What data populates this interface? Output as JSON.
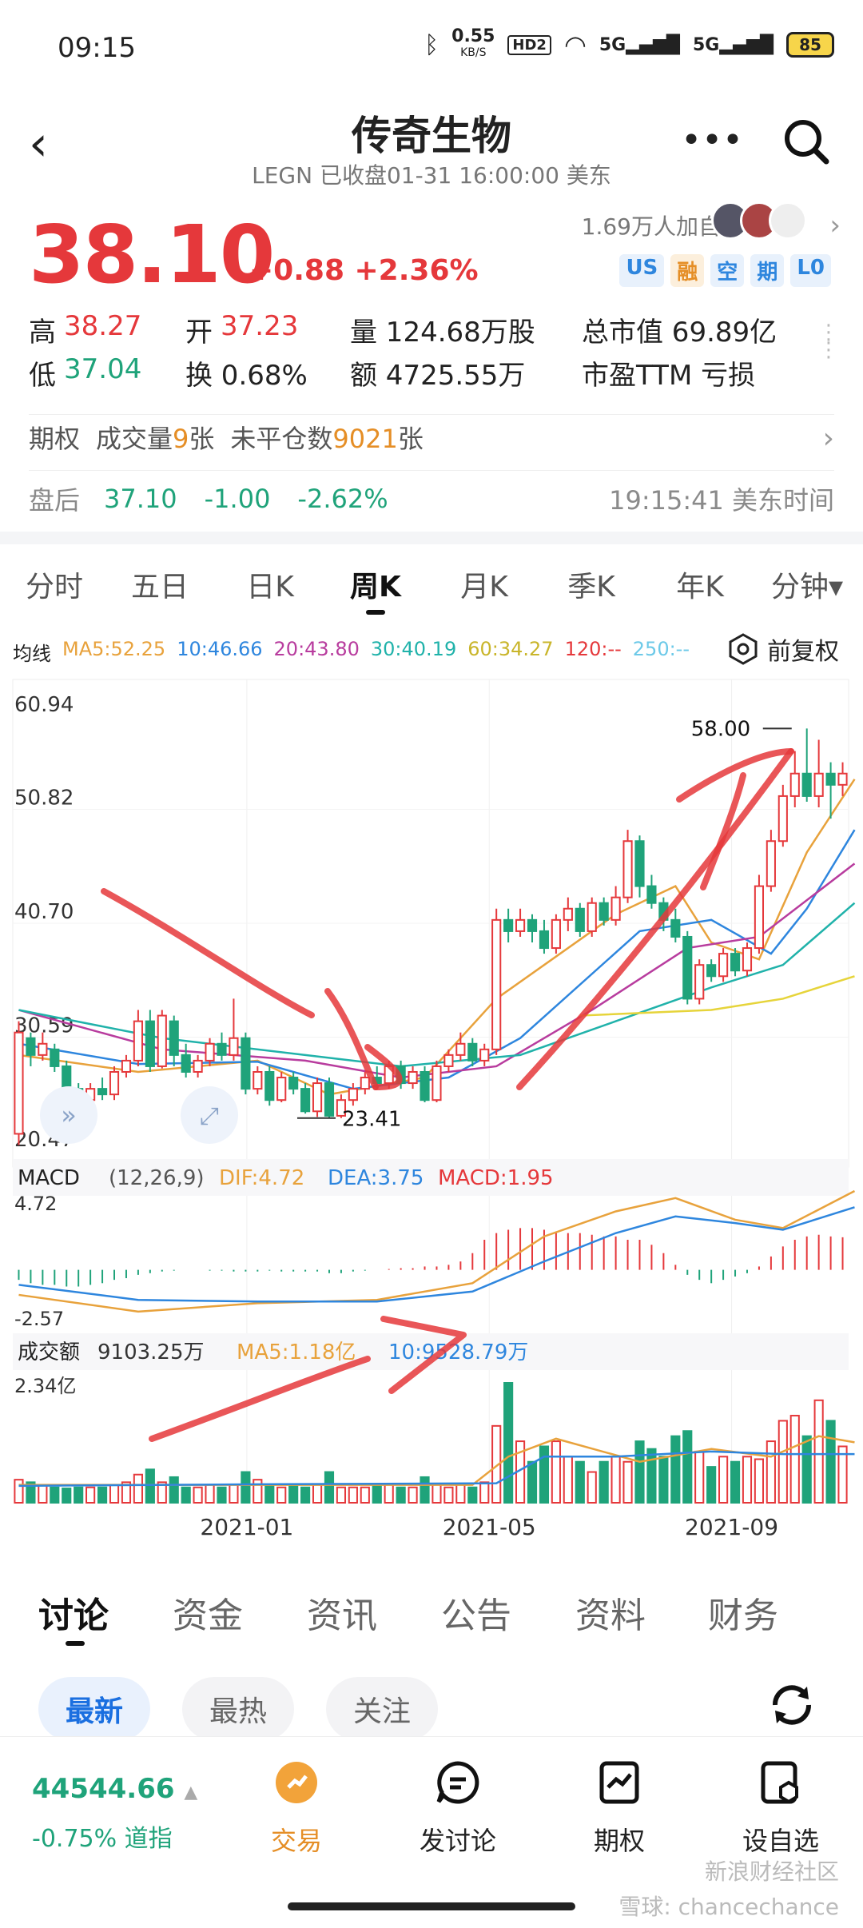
{
  "status": {
    "time": "09:15",
    "net_speed": "0.55",
    "net_unit": "KB/S",
    "hd": "HD2",
    "sig1": "5G",
    "sig2": "5G",
    "battery": "85"
  },
  "header": {
    "title": "传奇生物",
    "subtitle": "LEGN 已收盘01-31 16:00:00 美东"
  },
  "quote": {
    "price": "38.10",
    "change": "+0.88 +2.36%",
    "followers": "1.69万人加自选",
    "tags": [
      "US",
      "融",
      "空",
      "期",
      "L0"
    ]
  },
  "stats": {
    "high_label": "高",
    "high": "38.27",
    "open_label": "开",
    "open": "37.23",
    "volume": "量 124.68万股",
    "mktcap": "总市值 69.89亿",
    "low_label": "低",
    "low": "37.04",
    "turnover": "换 0.68%",
    "amount": "额 4725.55万",
    "pe": "市盈TTM 亏损"
  },
  "options": {
    "label": "期权",
    "vol_label": "成交量",
    "vol": "9",
    "vol_unit": "张",
    "oi_label": "未平仓数",
    "oi": "9021",
    "oi_unit": "张"
  },
  "after_hours": {
    "label": "盘后",
    "price": "37.10",
    "change": "-1.00",
    "pct": "-2.62%",
    "time": "19:15:41 美东时间"
  },
  "tabs": [
    "分时",
    "五日",
    "日K",
    "周K",
    "月K",
    "季K",
    "年K",
    "分钟▾"
  ],
  "ma": {
    "label": "均线",
    "ma5": "MA5:52.25",
    "ma10": "10:46.66",
    "ma20": "20:43.80",
    "ma30": "30:40.19",
    "ma60": "60:34.27",
    "ma120": "120:--",
    "ma250": "250:--",
    "rehab": "前复权"
  },
  "colors": {
    "up": "#e5383b",
    "down": "#1fa37a",
    "ma5": "#e8a23c",
    "ma10": "#2e86de",
    "ma20": "#b83c9e",
    "ma30": "#20b2aa",
    "ma60": "#e6d43a"
  },
  "chart_data": {
    "type": "candlestick",
    "y_ticks": [
      "60.94",
      "50.82",
      "40.70",
      "30.59",
      "20.47"
    ],
    "high_marker": "58.00",
    "low_marker": "23.41",
    "macd": {
      "label": "MACD",
      "params": "(12,26,9)",
      "dif": "DIF:4.72",
      "dea": "DEA:3.75",
      "macd": "MACD:1.95",
      "y_top": "4.72",
      "y_bottom": "-2.57"
    },
    "turnover": {
      "label": "成交额",
      "value": "9103.25万",
      "ma5": "MA5:1.18亿",
      "ma10": "10:9528.79万",
      "y_top": "2.34亿"
    },
    "x_ticks": [
      "2021-01",
      "2021-05",
      "2021-09"
    ],
    "candles": [
      {
        "o": 22,
        "c": 31,
        "h": 32,
        "l": 21
      },
      {
        "o": 30.5,
        "c": 29,
        "h": 31,
        "l": 28
      },
      {
        "o": 29,
        "c": 30,
        "h": 31,
        "l": 28.5
      },
      {
        "o": 29.5,
        "c": 28,
        "h": 30,
        "l": 27.5
      },
      {
        "o": 28,
        "c": 26,
        "h": 28.5,
        "l": 25.5
      },
      {
        "o": 26,
        "c": 25,
        "h": 26.5,
        "l": 24.5
      },
      {
        "o": 25,
        "c": 26,
        "h": 26.5,
        "l": 24.8
      },
      {
        "o": 26,
        "c": 25.5,
        "h": 27,
        "l": 25
      },
      {
        "o": 25.5,
        "c": 27.5,
        "h": 28,
        "l": 25
      },
      {
        "o": 27.5,
        "c": 28.5,
        "h": 29,
        "l": 27
      },
      {
        "o": 28.5,
        "c": 32,
        "h": 33,
        "l": 28
      },
      {
        "o": 32,
        "c": 28,
        "h": 33,
        "l": 27.5
      },
      {
        "o": 28,
        "c": 32.5,
        "h": 33,
        "l": 27.8
      },
      {
        "o": 32,
        "c": 29,
        "h": 32.5,
        "l": 28
      },
      {
        "o": 29,
        "c": 27.5,
        "h": 30,
        "l": 27
      },
      {
        "o": 27.5,
        "c": 28.5,
        "h": 29,
        "l": 27
      },
      {
        "o": 28.5,
        "c": 30,
        "h": 30.5,
        "l": 28
      },
      {
        "o": 30,
        "c": 29,
        "h": 31,
        "l": 28.5
      },
      {
        "o": 29,
        "c": 30.5,
        "h": 34,
        "l": 28.5
      },
      {
        "o": 30.5,
        "c": 26,
        "h": 31,
        "l": 25.5
      },
      {
        "o": 26,
        "c": 27.5,
        "h": 28,
        "l": 25.5
      },
      {
        "o": 27.5,
        "c": 25,
        "h": 28,
        "l": 24.5
      },
      {
        "o": 25,
        "c": 27,
        "h": 27.5,
        "l": 24.8
      },
      {
        "o": 27,
        "c": 26,
        "h": 27.5,
        "l": 25.5
      },
      {
        "o": 26,
        "c": 24,
        "h": 26.5,
        "l": 23.8
      },
      {
        "o": 24,
        "c": 26.5,
        "h": 27,
        "l": 23.5
      },
      {
        "o": 26.5,
        "c": 23.6,
        "h": 27,
        "l": 23.4
      },
      {
        "o": 23.6,
        "c": 25,
        "h": 25.5,
        "l": 23.4
      },
      {
        "o": 25,
        "c": 26,
        "h": 26.5,
        "l": 24.5
      },
      {
        "o": 26,
        "c": 27,
        "h": 27.5,
        "l": 25.5
      },
      {
        "o": 27,
        "c": 26.5,
        "h": 28,
        "l": 26
      },
      {
        "o": 26.5,
        "c": 28,
        "h": 28.5,
        "l": 26
      },
      {
        "o": 28,
        "c": 26.5,
        "h": 28.5,
        "l": 26
      },
      {
        "o": 26.5,
        "c": 27.5,
        "h": 28,
        "l": 26
      },
      {
        "o": 27.5,
        "c": 25,
        "h": 28,
        "l": 24.8
      },
      {
        "o": 25,
        "c": 28,
        "h": 28.5,
        "l": 24.8
      },
      {
        "o": 28,
        "c": 29,
        "h": 29.5,
        "l": 27.5
      },
      {
        "o": 29,
        "c": 30,
        "h": 31,
        "l": 28.5
      },
      {
        "o": 30,
        "c": 28.5,
        "h": 30.5,
        "l": 28
      },
      {
        "o": 28.5,
        "c": 29.5,
        "h": 30,
        "l": 28
      },
      {
        "o": 29.5,
        "c": 41,
        "h": 42,
        "l": 29
      },
      {
        "o": 41,
        "c": 40,
        "h": 42,
        "l": 39
      },
      {
        "o": 40,
        "c": 41,
        "h": 42,
        "l": 39.5
      },
      {
        "o": 41,
        "c": 40,
        "h": 41.5,
        "l": 39
      },
      {
        "o": 40,
        "c": 38.5,
        "h": 41,
        "l": 38
      },
      {
        "o": 38.5,
        "c": 41,
        "h": 41.5,
        "l": 38
      },
      {
        "o": 41,
        "c": 42,
        "h": 43,
        "l": 40
      },
      {
        "o": 42,
        "c": 40,
        "h": 42.5,
        "l": 39.5
      },
      {
        "o": 40,
        "c": 42.5,
        "h": 43,
        "l": 39.5
      },
      {
        "o": 42.5,
        "c": 41,
        "h": 43,
        "l": 40.5
      },
      {
        "o": 41,
        "c": 43,
        "h": 44,
        "l": 40.5
      },
      {
        "o": 43,
        "c": 48,
        "h": 49,
        "l": 42.5
      },
      {
        "o": 48,
        "c": 44,
        "h": 48.5,
        "l": 43
      },
      {
        "o": 44,
        "c": 42.5,
        "h": 45,
        "l": 42
      },
      {
        "o": 42.5,
        "c": 41,
        "h": 43,
        "l": 40
      },
      {
        "o": 41,
        "c": 39.5,
        "h": 42,
        "l": 39
      },
      {
        "o": 39.5,
        "c": 34,
        "h": 40,
        "l": 33.5
      },
      {
        "o": 34,
        "c": 37,
        "h": 37.5,
        "l": 33.5
      },
      {
        "o": 37,
        "c": 36,
        "h": 37.5,
        "l": 35.5
      },
      {
        "o": 36,
        "c": 38,
        "h": 38.5,
        "l": 35.5
      },
      {
        "o": 38,
        "c": 36.5,
        "h": 38.5,
        "l": 36
      },
      {
        "o": 36.5,
        "c": 38.5,
        "h": 39,
        "l": 36
      },
      {
        "o": 38.5,
        "c": 44,
        "h": 45,
        "l": 38
      },
      {
        "o": 44,
        "c": 48,
        "h": 49,
        "l": 43.5
      },
      {
        "o": 48,
        "c": 52,
        "h": 53,
        "l": 47.5
      },
      {
        "o": 52,
        "c": 54,
        "h": 56,
        "l": 51
      },
      {
        "o": 54,
        "c": 52,
        "h": 58,
        "l": 51.5
      },
      {
        "o": 52,
        "c": 54,
        "h": 57,
        "l": 51
      },
      {
        "o": 54,
        "c": 53,
        "h": 55,
        "l": 50
      },
      {
        "o": 53,
        "c": 54,
        "h": 55,
        "l": 52
      }
    ],
    "ma_lines": {
      "ma5": [
        [
          0,
          29
        ],
        [
          10,
          27.5
        ],
        [
          20,
          28.5
        ],
        [
          26,
          25.5
        ],
        [
          34,
          27
        ],
        [
          40,
          34
        ],
        [
          50,
          41.5
        ],
        [
          55,
          44
        ],
        [
          58,
          39
        ],
        [
          62,
          37.5
        ],
        [
          66,
          47
        ],
        [
          70,
          53.5
        ]
      ],
      "ma10": [
        [
          0,
          30
        ],
        [
          10,
          28.2
        ],
        [
          20,
          28.4
        ],
        [
          28,
          26
        ],
        [
          36,
          27
        ],
        [
          42,
          30.5
        ],
        [
          52,
          40
        ],
        [
          58,
          41
        ],
        [
          63,
          38
        ],
        [
          66,
          42
        ],
        [
          70,
          49
        ]
      ],
      "ma20": [
        [
          0,
          33
        ],
        [
          12,
          29.5
        ],
        [
          24,
          28.5
        ],
        [
          32,
          27
        ],
        [
          40,
          28
        ],
        [
          48,
          33
        ],
        [
          56,
          38.5
        ],
        [
          62,
          39.5
        ],
        [
          70,
          46
        ]
      ],
      "ma30": [
        [
          0,
          33
        ],
        [
          12,
          30.5
        ],
        [
          24,
          29
        ],
        [
          32,
          28
        ],
        [
          42,
          29
        ],
        [
          50,
          32
        ],
        [
          58,
          35
        ],
        [
          64,
          37
        ],
        [
          70,
          42.5
        ]
      ],
      "ma60": [
        [
          47,
          32.5
        ],
        [
          58,
          33
        ],
        [
          64,
          34
        ],
        [
          70,
          36
        ]
      ]
    },
    "macd_hist": [
      -0.6,
      -0.8,
      -0.9,
      -0.9,
      -1.0,
      -1.0,
      -0.9,
      -0.8,
      -0.6,
      -0.5,
      -0.3,
      -0.2,
      -0.1,
      -0.05,
      0.0,
      0.0,
      -0.05,
      -0.05,
      -0.1,
      -0.1,
      -0.1,
      -0.05,
      -0.1,
      -0.1,
      -0.1,
      -0.1,
      -0.2,
      -0.2,
      -0.1,
      -0.05,
      0.0,
      0.05,
      0.1,
      0.1,
      0.2,
      0.2,
      0.3,
      0.5,
      1.0,
      1.8,
      2.2,
      2.4,
      2.5,
      2.5,
      2.4,
      2.3,
      2.2,
      2.2,
      2.1,
      2.0,
      2.0,
      1.8,
      1.8,
      1.5,
      1.0,
      0.3,
      -0.3,
      -0.6,
      -0.8,
      -0.6,
      -0.4,
      -0.2,
      0.2,
      0.8,
      1.4,
      1.8,
      2.0,
      2.1,
      2.0,
      1.95
    ],
    "macd_dif": [
      [
        0,
        -1.5
      ],
      [
        10,
        -2.5
      ],
      [
        20,
        -2.0
      ],
      [
        30,
        -1.8
      ],
      [
        38,
        -0.8
      ],
      [
        44,
        2.0
      ],
      [
        50,
        3.5
      ],
      [
        55,
        4.3
      ],
      [
        60,
        3.0
      ],
      [
        64,
        2.5
      ],
      [
        70,
        4.72
      ]
    ],
    "macd_dea": [
      [
        0,
        -0.9
      ],
      [
        10,
        -1.8
      ],
      [
        20,
        -1.9
      ],
      [
        30,
        -1.9
      ],
      [
        38,
        -1.3
      ],
      [
        44,
        0.5
      ],
      [
        50,
        2.2
      ],
      [
        55,
        3.2
      ],
      [
        60,
        2.8
      ],
      [
        64,
        2.4
      ],
      [
        70,
        3.75
      ]
    ],
    "vol": [
      0.45,
      0.4,
      0.35,
      0.3,
      0.28,
      0.3,
      0.3,
      0.3,
      0.35,
      0.4,
      0.55,
      0.65,
      0.4,
      0.5,
      0.3,
      0.3,
      0.35,
      0.3,
      0.35,
      0.6,
      0.45,
      0.35,
      0.3,
      0.35,
      0.3,
      0.35,
      0.6,
      0.3,
      0.3,
      0.3,
      0.35,
      0.35,
      0.3,
      0.3,
      0.5,
      0.35,
      0.3,
      0.35,
      0.3,
      0.4,
      1.5,
      2.34,
      1.2,
      0.8,
      1.1,
      1.2,
      0.9,
      0.8,
      0.6,
      0.8,
      0.9,
      0.8,
      1.2,
      1.05,
      0.9,
      1.3,
      1.4,
      1.0,
      0.7,
      0.9,
      0.8,
      0.9,
      0.85,
      1.2,
      1.6,
      1.7,
      1.3,
      2.0,
      1.6,
      1.1
    ],
    "vol_ma5": [
      [
        0,
        0.35
      ],
      [
        20,
        0.35
      ],
      [
        38,
        0.35
      ],
      [
        41,
        0.9
      ],
      [
        45,
        1.25
      ],
      [
        52,
        0.8
      ],
      [
        58,
        1.05
      ],
      [
        63,
        0.9
      ],
      [
        67,
        1.3
      ],
      [
        70,
        1.18
      ]
    ],
    "vol_ma10": [
      [
        0,
        0.33
      ],
      [
        20,
        0.36
      ],
      [
        40,
        0.38
      ],
      [
        44,
        0.9
      ],
      [
        50,
        0.9
      ],
      [
        58,
        1.0
      ],
      [
        64,
        0.95
      ],
      [
        70,
        0.95
      ]
    ]
  },
  "bottom_tabs": [
    "讨论",
    "资金",
    "资讯",
    "公告",
    "资料",
    "财务"
  ],
  "pills": [
    "最新",
    "最热",
    "关注"
  ],
  "bottombar": {
    "index_value": "44544.66",
    "index_change": "-0.75% 道指",
    "items": [
      "交易",
      "发讨论",
      "期权",
      "设自选"
    ]
  },
  "watermark": {
    "line1": "新浪财经社区",
    "line2": "雪球: chancechance"
  }
}
